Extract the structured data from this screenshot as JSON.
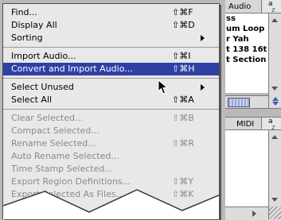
{
  "menu": {
    "items": [
      {
        "label": "Find...",
        "shortcut": "⇧⌘F"
      },
      {
        "label": "Display All",
        "shortcut": "⇧⌘D"
      },
      {
        "label": "Sorting",
        "shortcut": ""
      },
      {
        "label": "Import Audio...",
        "shortcut": "⇧⌘I"
      },
      {
        "label": "Convert and Import Audio...",
        "shortcut": "⇧⌘H"
      },
      {
        "label": "Select Unused",
        "shortcut": ""
      },
      {
        "label": "Select All",
        "shortcut": "⇧⌘A"
      },
      {
        "label": "Clear Selected...",
        "shortcut": "⇧⌘B"
      },
      {
        "label": "Compact Selected...",
        "shortcut": ""
      },
      {
        "label": "Rename Selected...",
        "shortcut": "⇧⌘R"
      },
      {
        "label": "Auto Rename Selected...",
        "shortcut": ""
      },
      {
        "label": "Time Stamp Selected...",
        "shortcut": ""
      },
      {
        "label": "Export Region Definitions...",
        "shortcut": "⇧⌘Y"
      },
      {
        "label": "Export Selected As Files...",
        "shortcut": "⇧⌘K"
      }
    ]
  },
  "audio_bin": {
    "header": "Audio",
    "sort_icon": "a-z-sort-icon",
    "rows": [
      "ss",
      "um Loop",
      "r Yah",
      "t 138 16t",
      "t Section"
    ]
  },
  "midi_bin": {
    "header": "MIDI",
    "sort_icon": "a-z-sort-icon"
  },
  "colors": {
    "menu_highlight": "#2f3fa3",
    "menu_bg": "#e8e8e8",
    "disabled_text": "#8a8a8a"
  }
}
